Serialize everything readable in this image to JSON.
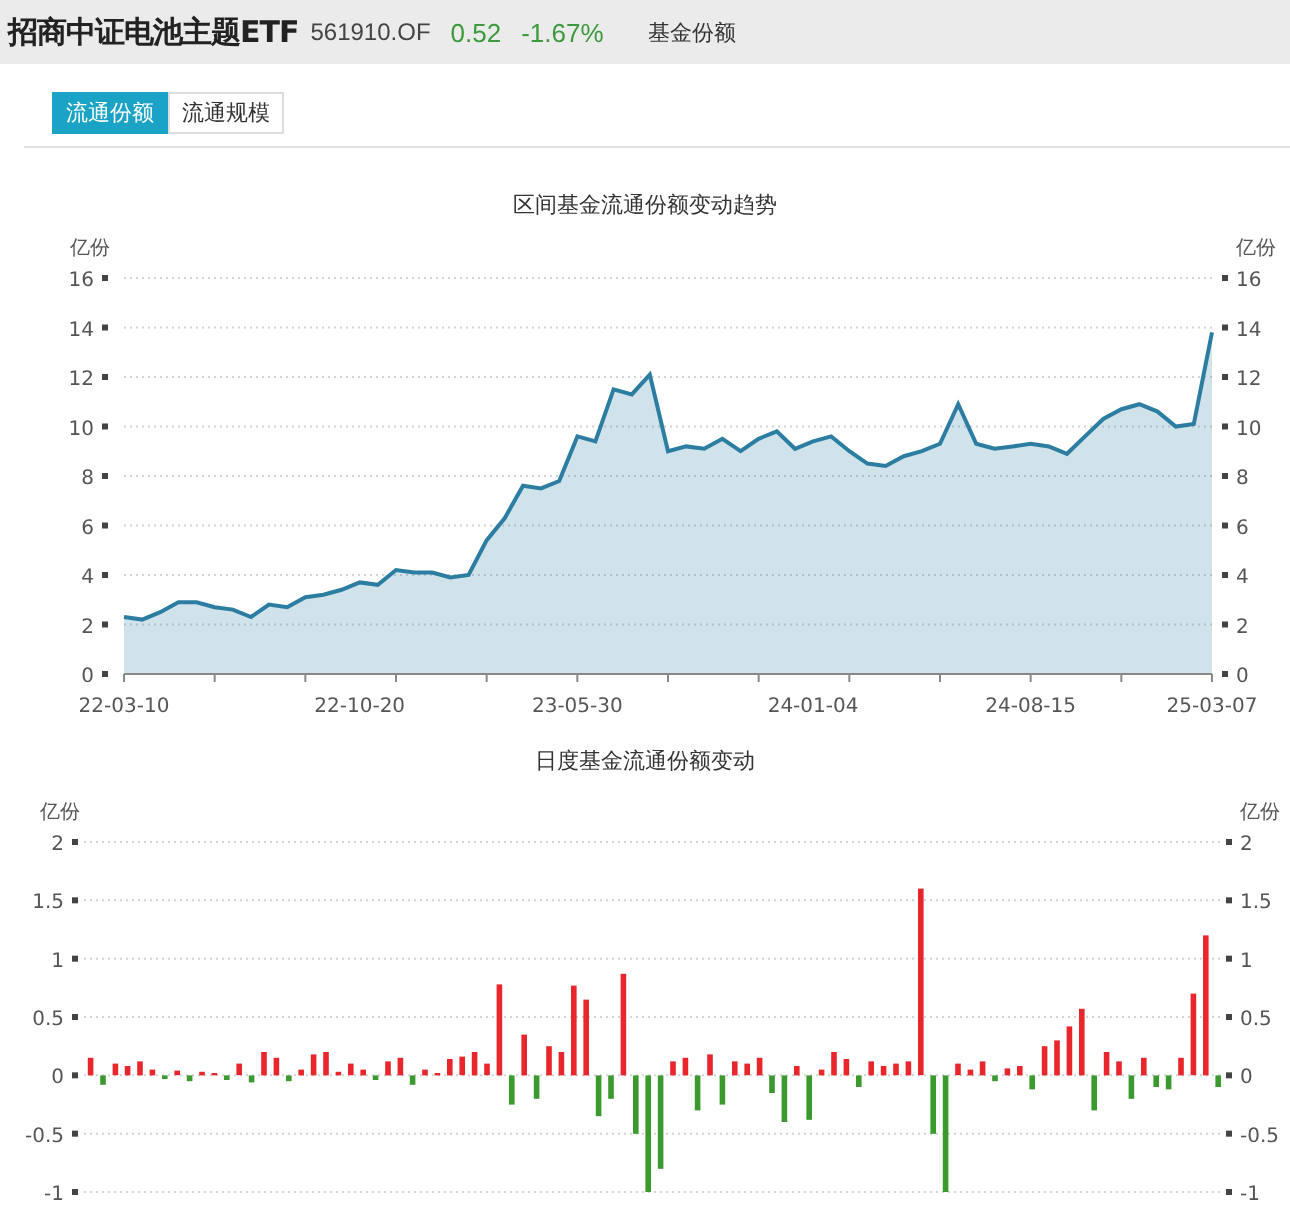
{
  "header": {
    "title": "招商中证电池主题ETF",
    "code": "561910.OF",
    "price": "0.52",
    "change": "-1.67%",
    "section": "基金份额"
  },
  "tabs": [
    {
      "label": "流通份额",
      "selected": true
    },
    {
      "label": "流通规模",
      "selected": false
    }
  ],
  "trend": {
    "chart_data": {
      "type": "area",
      "title": "区间基金流通份额变动趋势",
      "ylabel": "亿份",
      "y2label": "亿份",
      "ylim": [
        0,
        16
      ],
      "yticks": [
        0,
        2,
        4,
        6,
        8,
        10,
        12,
        14,
        16
      ],
      "y2lim": [
        0,
        16
      ],
      "y2ticks": [
        0,
        2,
        4,
        6,
        8,
        10,
        12,
        14,
        16
      ],
      "grid": true,
      "categories": [
        "22-03-10",
        null,
        null,
        null,
        null,
        null,
        null,
        null,
        null,
        null,
        null,
        null,
        null,
        "22-10-20",
        null,
        null,
        null,
        null,
        null,
        null,
        null,
        null,
        null,
        null,
        null,
        "23-05-30",
        null,
        null,
        null,
        null,
        null,
        null,
        null,
        null,
        null,
        null,
        null,
        null,
        "24-01-04",
        null,
        null,
        null,
        null,
        null,
        null,
        null,
        null,
        null,
        null,
        null,
        "24-08-15",
        null,
        null,
        null,
        null,
        null,
        null,
        null,
        null,
        null,
        "25-03-07"
      ],
      "series": [
        {
          "color": "#2b7ea1",
          "values": [
            2.3,
            2.2,
            2.5,
            2.9,
            2.9,
            2.7,
            2.6,
            2.3,
            2.8,
            2.7,
            3.1,
            3.2,
            3.4,
            3.7,
            3.6,
            4.2,
            4.1,
            4.1,
            3.9,
            4.0,
            5.4,
            6.3,
            7.6,
            7.5,
            7.8,
            9.6,
            9.4,
            11.5,
            11.3,
            12.1,
            9.0,
            9.2,
            9.1,
            9.5,
            9.0,
            9.5,
            9.8,
            9.1,
            9.4,
            9.6,
            9.0,
            8.5,
            8.4,
            8.8,
            9.0,
            9.3,
            10.9,
            9.3,
            9.1,
            9.2,
            9.3,
            9.2,
            8.9,
            9.6,
            10.3,
            10.7,
            10.9,
            10.6,
            10.0,
            10.1,
            13.8
          ]
        }
      ]
    }
  },
  "daily": {
    "chart_data": {
      "type": "bar",
      "title": "日度基金流通份额变动",
      "ylabel": "亿份",
      "y2label": "亿份",
      "ylim": [
        -1,
        2
      ],
      "yticks": [
        -1,
        -0.5,
        0,
        0.5,
        1,
        1.5,
        2
      ],
      "y2lim": [
        -1,
        2
      ],
      "y2ticks": [
        -1,
        -0.5,
        0,
        0.5,
        1,
        1.5,
        2
      ],
      "grid": true,
      "stacked": true,
      "series": [
        {
          "color": "#e8262b",
          "values": [
            0.15,
            null,
            0.1,
            0.08,
            0.12,
            0.05,
            null,
            0.04,
            null,
            0.03,
            0.02,
            null,
            0.1,
            null,
            0.2,
            0.15,
            null,
            0.05,
            0.18,
            0.2,
            0.03,
            0.1,
            0.05,
            null,
            0.12,
            0.15,
            null,
            0.05,
            0.02,
            0.14,
            0.16,
            0.2,
            0.1,
            0.78,
            null,
            0.35,
            null,
            0.25,
            0.2,
            0.77,
            0.65,
            null,
            null,
            0.87,
            null,
            null,
            null,
            0.12,
            0.15,
            null,
            0.18,
            null,
            0.12,
            0.1,
            0.15,
            null,
            null,
            0.08,
            null,
            0.05,
            0.2,
            0.14,
            null,
            0.12,
            0.08,
            0.1,
            0.12,
            1.6,
            null,
            null,
            0.1,
            0.05,
            0.12,
            null,
            0.06,
            0.08,
            null,
            0.25,
            0.3,
            0.42,
            0.57,
            null,
            0.2,
            0.12,
            null,
            0.15,
            null,
            null,
            0.15,
            0.7,
            1.2,
            null
          ]
        },
        {
          "color": "#3a9a2d",
          "values": [
            null,
            -0.08,
            null,
            null,
            null,
            null,
            -0.03,
            null,
            -0.05,
            null,
            null,
            -0.04,
            null,
            -0.06,
            null,
            null,
            -0.05,
            null,
            null,
            null,
            null,
            null,
            null,
            -0.04,
            null,
            null,
            -0.08,
            null,
            null,
            null,
            null,
            null,
            null,
            null,
            -0.25,
            null,
            -0.2,
            null,
            null,
            null,
            null,
            -0.35,
            -0.2,
            null,
            -0.5,
            -1,
            -0.8,
            null,
            null,
            -0.3,
            null,
            -0.25,
            null,
            null,
            null,
            -0.15,
            -0.4,
            null,
            -0.38,
            null,
            null,
            null,
            -0.1,
            null,
            null,
            null,
            null,
            null,
            -0.5,
            -1,
            null,
            null,
            null,
            -0.05,
            null,
            null,
            -0.12,
            null,
            null,
            null,
            null,
            -0.3,
            null,
            null,
            -0.2,
            null,
            -0.1,
            -0.12,
            null,
            null,
            null,
            -0.1
          ]
        }
      ]
    }
  }
}
